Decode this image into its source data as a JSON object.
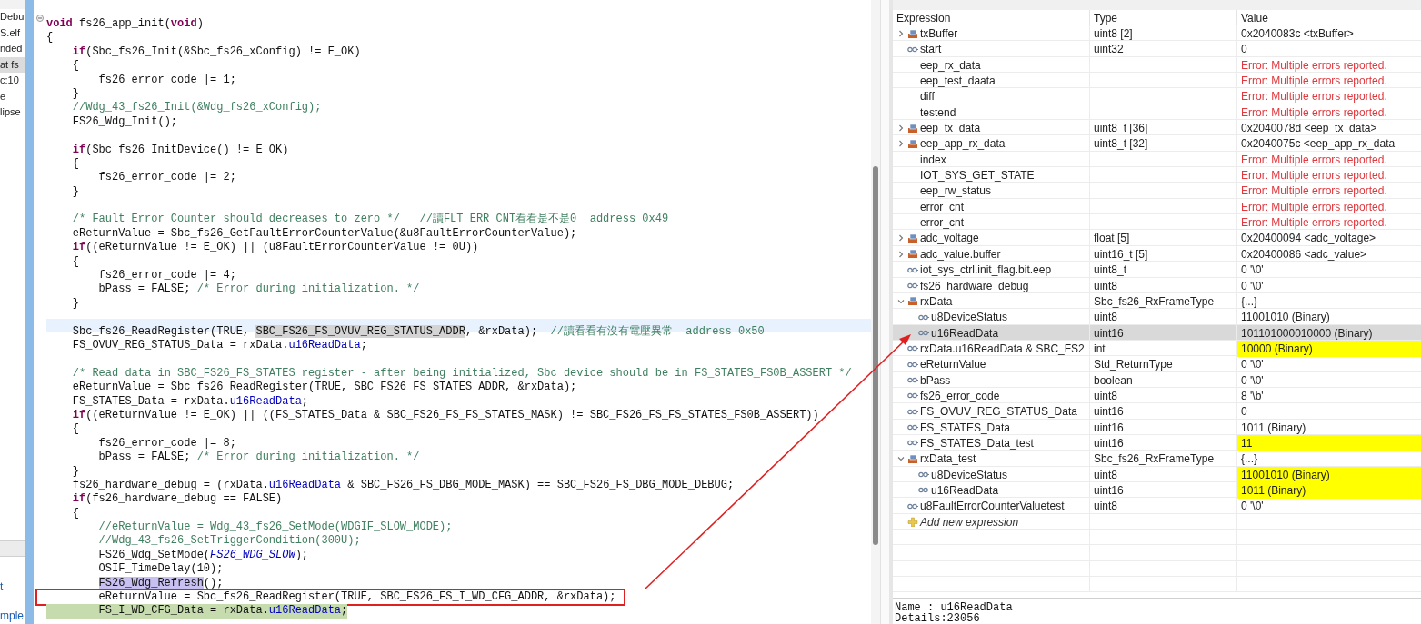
{
  "left_panel": {
    "items": [
      {
        "label": "Debu",
        "selected": false
      },
      {
        "label": "S.elf",
        "selected": false
      },
      {
        "label": "nded",
        "selected": false
      },
      {
        "label": "at fs",
        "selected": true
      },
      {
        "label": "c:10",
        "selected": false
      },
      {
        "label": "e",
        "selected": false
      },
      {
        "label": "lipse",
        "selected": false
      }
    ],
    "bottom_links": [
      "t",
      "mple"
    ]
  },
  "editor": {
    "lines": [
      {
        "kind": "code",
        "collapsible": true,
        "segments": [
          {
            "kind": "keyword",
            "text": "void"
          },
          {
            "kind": "plain",
            "text": " fs26_app_init("
          },
          {
            "kind": "keyword",
            "text": "void"
          },
          {
            "kind": "plain",
            "text": ")"
          }
        ]
      },
      {
        "kind": "code",
        "segments": [
          {
            "kind": "plain",
            "text": "{"
          }
        ]
      },
      {
        "kind": "code",
        "segments": [
          {
            "kind": "keyword",
            "text": "    if"
          },
          {
            "kind": "plain",
            "text": "(Sbc_fs26_Init(&Sbc_fs26_xConfig) != E_OK)"
          }
        ]
      },
      {
        "kind": "code",
        "segments": [
          {
            "kind": "plain",
            "text": "    {"
          }
        ]
      },
      {
        "kind": "code",
        "segments": [
          {
            "kind": "plain",
            "text": "        fs26_error_code |= 1;"
          }
        ]
      },
      {
        "kind": "code",
        "segments": [
          {
            "kind": "plain",
            "text": "    }"
          }
        ]
      },
      {
        "kind": "code",
        "segments": [
          {
            "kind": "comment",
            "text": "    //Wdg_43_fs26_Init(&Wdg_fs26_xConfig);"
          }
        ]
      },
      {
        "kind": "code",
        "segments": [
          {
            "kind": "plain",
            "text": "    FS26_Wdg_Init();"
          }
        ]
      },
      {
        "kind": "blank"
      },
      {
        "kind": "code",
        "segments": [
          {
            "kind": "keyword",
            "text": "    if"
          },
          {
            "kind": "plain",
            "text": "(Sbc_fs26_InitDevice() != E_OK)"
          }
        ]
      },
      {
        "kind": "code",
        "segments": [
          {
            "kind": "plain",
            "text": "    {"
          }
        ]
      },
      {
        "kind": "code",
        "segments": [
          {
            "kind": "plain",
            "text": "        fs26_error_code |= 2;"
          }
        ]
      },
      {
        "kind": "code",
        "segments": [
          {
            "kind": "plain",
            "text": "    }"
          }
        ]
      },
      {
        "kind": "blank"
      },
      {
        "kind": "code",
        "segments": [
          {
            "kind": "comment",
            "text": "    /* Fault Error Counter should decreases to zero */   //讀FLT_ERR_CNT看看是不是0  address 0x49"
          }
        ]
      },
      {
        "kind": "code",
        "segments": [
          {
            "kind": "plain",
            "text": "    eReturnValue = Sbc_fs26_GetFaultErrorCounterValue(&u8FaultErrorCounterValue);"
          }
        ]
      },
      {
        "kind": "code",
        "segments": [
          {
            "kind": "keyword",
            "text": "    if"
          },
          {
            "kind": "plain",
            "text": "((eReturnValue != E_OK) || (u8FaultErrorCounterValue != 0U))"
          }
        ]
      },
      {
        "kind": "code",
        "segments": [
          {
            "kind": "plain",
            "text": "    {"
          }
        ]
      },
      {
        "kind": "code",
        "segments": [
          {
            "kind": "plain",
            "text": "        fs26_error_code |= 4;"
          }
        ]
      },
      {
        "kind": "code",
        "segments": [
          {
            "kind": "plain",
            "text": "        bPass = FALSE; "
          },
          {
            "kind": "comment",
            "text": "/* Error during initialization. */"
          }
        ]
      },
      {
        "kind": "code",
        "segments": [
          {
            "kind": "plain",
            "text": "    }"
          }
        ]
      },
      {
        "kind": "blank"
      },
      {
        "kind": "code",
        "current": true,
        "segments": [
          {
            "kind": "plain",
            "text": "    Sbc_fs26_ReadRegister(TRUE, "
          },
          {
            "kind": "occurrence",
            "text": "SBC_FS26_FS_OVUV_REG_STATUS_ADDR"
          },
          {
            "kind": "plain",
            "text": ", &rxData);  "
          },
          {
            "kind": "comment",
            "text": "//讀看看有沒有電壓異常  address 0x50"
          }
        ]
      },
      {
        "kind": "code",
        "segments": [
          {
            "kind": "plain",
            "text": "    FS_OVUV_REG_STATUS_Data = rxData."
          },
          {
            "kind": "field",
            "text": "u16ReadData"
          },
          {
            "kind": "plain",
            "text": ";"
          }
        ]
      },
      {
        "kind": "blank"
      },
      {
        "kind": "code",
        "segments": [
          {
            "kind": "comment",
            "text": "    /* Read data in SBC_FS26_FS_STATES register - after being initialized, Sbc device should be in FS_STATES_FS0B_ASSERT */"
          }
        ]
      },
      {
        "kind": "code",
        "segments": [
          {
            "kind": "plain",
            "text": "    eReturnValue = Sbc_fs26_ReadRegister(TRUE, SBC_FS26_FS_STATES_ADDR, &rxData);"
          }
        ]
      },
      {
        "kind": "code",
        "segments": [
          {
            "kind": "plain",
            "text": "    FS_STATES_Data = rxData."
          },
          {
            "kind": "field",
            "text": "u16ReadData"
          },
          {
            "kind": "plain",
            "text": ";"
          }
        ]
      },
      {
        "kind": "code",
        "segments": [
          {
            "kind": "keyword",
            "text": "    if"
          },
          {
            "kind": "plain",
            "text": "((eReturnValue != E_OK) || ((FS_STATES_Data & SBC_FS26_FS_FS_STATES_MASK) != SBC_FS26_FS_FS_STATES_FS0B_ASSERT))"
          }
        ]
      },
      {
        "kind": "code",
        "segments": [
          {
            "kind": "plain",
            "text": "    {"
          }
        ]
      },
      {
        "kind": "code",
        "segments": [
          {
            "kind": "plain",
            "text": "        fs26_error_code |= 8;"
          }
        ]
      },
      {
        "kind": "code",
        "segments": [
          {
            "kind": "plain",
            "text": "        bPass = FALSE; "
          },
          {
            "kind": "comment",
            "text": "/* Error during initialization. */"
          }
        ]
      },
      {
        "kind": "code",
        "segments": [
          {
            "kind": "plain",
            "text": "    }"
          }
        ]
      },
      {
        "kind": "code",
        "segments": [
          {
            "kind": "plain",
            "text": "    fs26_hardware_debug = (rxData."
          },
          {
            "kind": "field",
            "text": "u16ReadData"
          },
          {
            "kind": "plain",
            "text": " & SBC_FS26_FS_DBG_MODE_MASK) == SBC_FS26_FS_DBG_MODE_DEBUG;"
          }
        ]
      },
      {
        "kind": "code",
        "segments": [
          {
            "kind": "keyword",
            "text": "    if"
          },
          {
            "kind": "plain",
            "text": "(fs26_hardware_debug == FALSE)"
          }
        ]
      },
      {
        "kind": "code",
        "segments": [
          {
            "kind": "plain",
            "text": "    {"
          }
        ]
      },
      {
        "kind": "code",
        "segments": [
          {
            "kind": "comment",
            "text": "        //eReturnValue = Wdg_43_fs26_SetMode(WDGIF_SLOW_MODE);"
          }
        ]
      },
      {
        "kind": "code",
        "segments": [
          {
            "kind": "comment",
            "text": "        //Wdg_43_fs26_SetTriggerCondition(300U);"
          }
        ]
      },
      {
        "kind": "code",
        "segments": [
          {
            "kind": "plain",
            "text": "        FS26_Wdg_SetMode("
          },
          {
            "kind": "constant",
            "text": "FS26_WDG_SLOW"
          },
          {
            "kind": "plain",
            "text": ");"
          }
        ]
      },
      {
        "kind": "code",
        "segments": [
          {
            "kind": "plain",
            "text": "        OSIF_TimeDelay(10);"
          }
        ]
      },
      {
        "kind": "code",
        "segments": [
          {
            "kind": "write_occurrence",
            "text": "        FS26_Wdg_Refresh"
          },
          {
            "kind": "plain",
            "text": "();"
          }
        ]
      },
      {
        "kind": "code",
        "annotated": true,
        "segments": [
          {
            "kind": "plain",
            "text": "        eReturnValue = Sbc_fs26_ReadRegister(TRUE, SBC_FS26_FS_I_WD_CFG_ADDR, &rxData);"
          }
        ]
      },
      {
        "kind": "code",
        "executing": true,
        "segments": [
          {
            "kind": "plain",
            "text": "        FS_I_WD_CFG_Data = rxData."
          },
          {
            "kind": "field",
            "text": "u16ReadData"
          },
          {
            "kind": "plain",
            "text": ";"
          }
        ]
      }
    ]
  },
  "expressions": {
    "columns": [
      "Expression",
      "Type",
      "Value"
    ],
    "rows": [
      {
        "expression": "txBuffer",
        "type": "uint8 [2]",
        "value": "0x2040083c <txBuffer>",
        "kind": "array",
        "expanded": false,
        "selected": false,
        "changed": false,
        "error": false
      },
      {
        "expression": "start",
        "type": "uint32",
        "value": "0",
        "kind": "variable",
        "selected": false,
        "changed": false,
        "error": false
      },
      {
        "expression": "eep_rx_data",
        "value": "Error: Multiple errors reported.",
        "kind": "plain",
        "selected": false,
        "changed": false,
        "error": true
      },
      {
        "expression": "eep_test_daata",
        "value": "Error: Multiple errors reported.",
        "kind": "plain",
        "selected": false,
        "changed": false,
        "error": true
      },
      {
        "expression": "diff",
        "value": "Error: Multiple errors reported.",
        "kind": "plain",
        "selected": false,
        "changed": false,
        "error": true
      },
      {
        "expression": "testend",
        "value": "Error: Multiple errors reported.",
        "kind": "plain",
        "selected": false,
        "changed": false,
        "error": true
      },
      {
        "expression": "eep_tx_data",
        "type": "uint8_t [36]",
        "value": "0x2040078d <eep_tx_data>",
        "kind": "array",
        "expanded": false,
        "selected": false,
        "changed": false,
        "error": false
      },
      {
        "expression": "eep_app_rx_data",
        "type": "uint8_t [32]",
        "value": "0x2040075c <eep_app_rx_data",
        "kind": "array",
        "expanded": false,
        "selected": false,
        "changed": false,
        "error": false
      },
      {
        "expression": "index",
        "value": "Error: Multiple errors reported.",
        "kind": "plain",
        "selected": false,
        "changed": false,
        "error": true
      },
      {
        "expression": "IOT_SYS_GET_STATE",
        "value": "Error: Multiple errors reported.",
        "kind": "plain",
        "selected": false,
        "changed": false,
        "error": true
      },
      {
        "expression": "eep_rw_status",
        "value": "Error: Multiple errors reported.",
        "kind": "plain",
        "selected": false,
        "changed": false,
        "error": true
      },
      {
        "expression": "error_cnt",
        "value": "Error: Multiple errors reported.",
        "kind": "plain",
        "selected": false,
        "changed": false,
        "error": true
      },
      {
        "expression": "error_cnt",
        "value": "Error: Multiple errors reported.",
        "kind": "plain",
        "selected": false,
        "changed": false,
        "error": true
      },
      {
        "expression": "adc_voltage",
        "type": "float [5]",
        "value": "0x20400094 <adc_voltage>",
        "kind": "array",
        "expanded": false,
        "selected": false,
        "changed": false,
        "error": false
      },
      {
        "expression": "adc_value.buffer",
        "type": "uint16_t [5]",
        "value": "0x20400086 <adc_value>",
        "kind": "array",
        "expanded": false,
        "selected": false,
        "changed": false,
        "error": false
      },
      {
        "expression": "iot_sys_ctrl.init_flag.bit.eep",
        "type": "uint8_t",
        "value": "0 '\\0'",
        "kind": "variable",
        "selected": false,
        "changed": false,
        "error": false
      },
      {
        "expression": "fs26_hardware_debug",
        "type": "uint8",
        "value": "0 '\\0'",
        "kind": "variable",
        "selected": false,
        "changed": false,
        "error": false
      },
      {
        "expression": "rxData",
        "type": "Sbc_fs26_RxFrameType",
        "value": "{...}",
        "kind": "array",
        "expanded": true,
        "selected": false,
        "changed": false,
        "error": false,
        "children": [
          {
            "expression": "u8DeviceStatus",
            "type": "uint8",
            "value": "11001010 (Binary)",
            "kind": "variable",
            "selected": false,
            "changed": false,
            "error": false
          },
          {
            "expression": "u16ReadData",
            "type": "uint16",
            "value": "101101000010000 (Binary)",
            "kind": "variable",
            "selected": true,
            "changed": false,
            "error": false
          }
        ]
      },
      {
        "expression": "rxData.u16ReadData & SBC_FS2",
        "type": "int",
        "value": "10000 (Binary)",
        "kind": "variable",
        "selected": false,
        "changed": true,
        "error": false
      },
      {
        "expression": "eReturnValue",
        "type": "Std_ReturnType",
        "value": "0 '\\0'",
        "kind": "variable",
        "selected": false,
        "changed": false,
        "error": false
      },
      {
        "expression": "bPass",
        "type": "boolean",
        "value": "0 '\\0'",
        "kind": "variable",
        "selected": false,
        "changed": false,
        "error": false
      },
      {
        "expression": "fs26_error_code",
        "type": "uint8",
        "value": "8 '\\b'",
        "kind": "variable",
        "selected": false,
        "changed": false,
        "error": false
      },
      {
        "expression": "FS_OVUV_REG_STATUS_Data",
        "type": "uint16",
        "value": "0",
        "kind": "variable",
        "selected": false,
        "changed": false,
        "error": false
      },
      {
        "expression": "FS_STATES_Data",
        "type": "uint16",
        "value": "1011 (Binary)",
        "kind": "variable",
        "selected": false,
        "changed": false,
        "error": false
      },
      {
        "expression": "FS_STATES_Data_test",
        "type": "uint16",
        "value": "11",
        "kind": "variable",
        "selected": false,
        "changed": true,
        "error": false
      },
      {
        "expression": "rxData_test",
        "type": "Sbc_fs26_RxFrameType",
        "value": "{...}",
        "kind": "array",
        "expanded": true,
        "selected": false,
        "changed": false,
        "error": false,
        "children": [
          {
            "expression": "u8DeviceStatus",
            "type": "uint8",
            "value": "11001010 (Binary)",
            "kind": "variable",
            "selected": false,
            "changed": true,
            "error": false
          },
          {
            "expression": "u16ReadData",
            "type": "uint16",
            "value": "1011 (Binary)",
            "kind": "variable",
            "selected": false,
            "changed": true,
            "error": false
          }
        ]
      },
      {
        "expression": "u8FaultErrorCounterValuetest",
        "type": "uint8",
        "value": "0 '\\0'",
        "kind": "variable",
        "selected": false,
        "changed": false,
        "error": false
      }
    ],
    "add_placeholder": "Add new expression"
  },
  "details": [
    "Name : u16ReadData",
    "Details:23056"
  ]
}
